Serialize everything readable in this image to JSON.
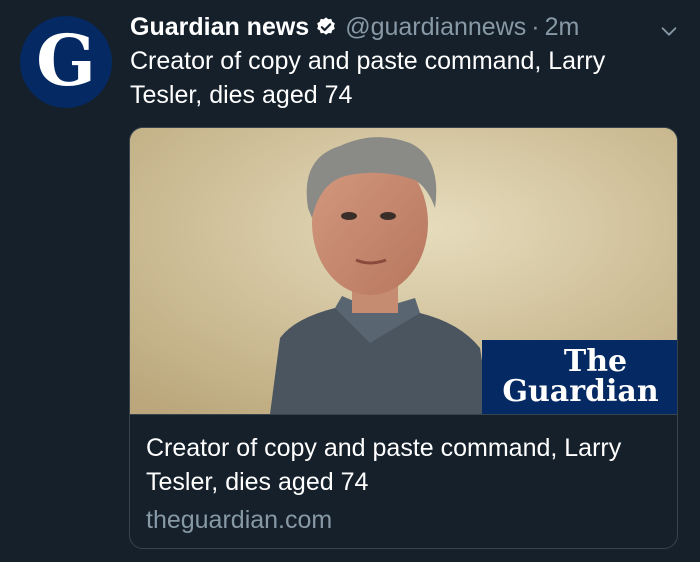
{
  "tweet": {
    "avatar_letter": "G",
    "avatar_icon": "guardian-logo-icon",
    "display_name": "Guardian news",
    "verified_icon": "verified-badge-icon",
    "handle": "@guardiannews",
    "separator": "·",
    "time": "2m",
    "menu_icon": "chevron-down-icon",
    "text": "Creator of copy and paste command, Larry Tesler, dies aged 74"
  },
  "card": {
    "image_brand_line1": "The",
    "image_brand_line2": "Guardian",
    "title": "Creator of copy and paste command, Larry Tesler, dies aged 74",
    "domain": "theguardian.com"
  },
  "colors": {
    "background": "#15202b",
    "secondary_text": "#8899a6",
    "guardian_blue": "#052962",
    "border": "#38444d"
  }
}
